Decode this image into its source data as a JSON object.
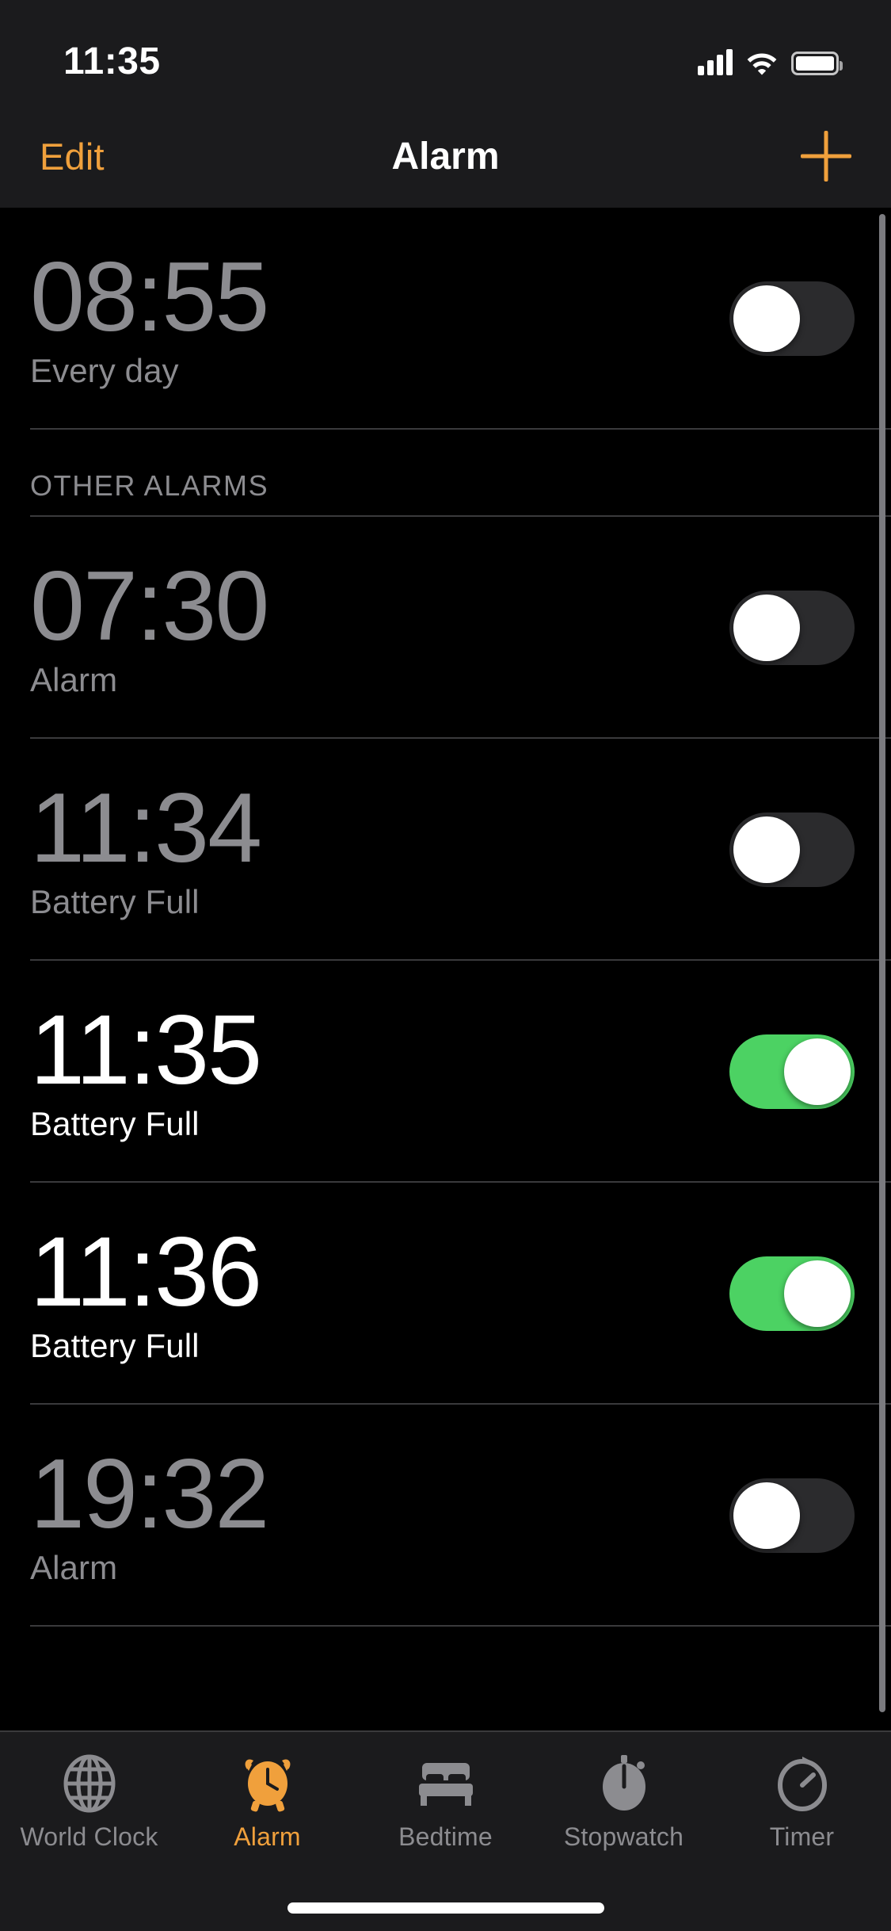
{
  "status_bar": {
    "time": "11:35",
    "icons": [
      "cellular-signal-icon",
      "wifi-icon",
      "battery-icon"
    ],
    "battery_level": "full"
  },
  "nav_bar": {
    "edit_label": "Edit",
    "title": "Alarm",
    "add_label": "+",
    "accent_color": "#F0A03C"
  },
  "colors": {
    "background": "#000000",
    "chrome": "#1B1B1D",
    "divider": "#3A3A3C",
    "disabled_text": "#8C8C90",
    "enabled_text": "#FFFFFF",
    "toggle_on": "#4CD263",
    "toggle_off": "#2B2B2D",
    "accent": "#F0A03C"
  },
  "sections": [
    {
      "header": null,
      "alarms": [
        {
          "time": "08:55",
          "label": "Every day",
          "enabled": false
        }
      ]
    },
    {
      "header": "OTHER ALARMS",
      "alarms": [
        {
          "time": "07:30",
          "label": "Alarm",
          "enabled": false
        },
        {
          "time": "11:34",
          "label": "Battery Full",
          "enabled": false
        },
        {
          "time": "11:35",
          "label": "Battery Full",
          "enabled": true
        },
        {
          "time": "11:36",
          "label": "Battery Full",
          "enabled": true
        },
        {
          "time": "19:32",
          "label": "Alarm",
          "enabled": false
        }
      ]
    }
  ],
  "tab_bar": {
    "items": [
      {
        "label": "World Clock",
        "icon": "globe-icon",
        "active": false
      },
      {
        "label": "Alarm",
        "icon": "alarm-clock-icon",
        "active": true
      },
      {
        "label": "Bedtime",
        "icon": "bed-icon",
        "active": false
      },
      {
        "label": "Stopwatch",
        "icon": "stopwatch-icon",
        "active": false
      },
      {
        "label": "Timer",
        "icon": "timer-icon",
        "active": false
      }
    ]
  }
}
